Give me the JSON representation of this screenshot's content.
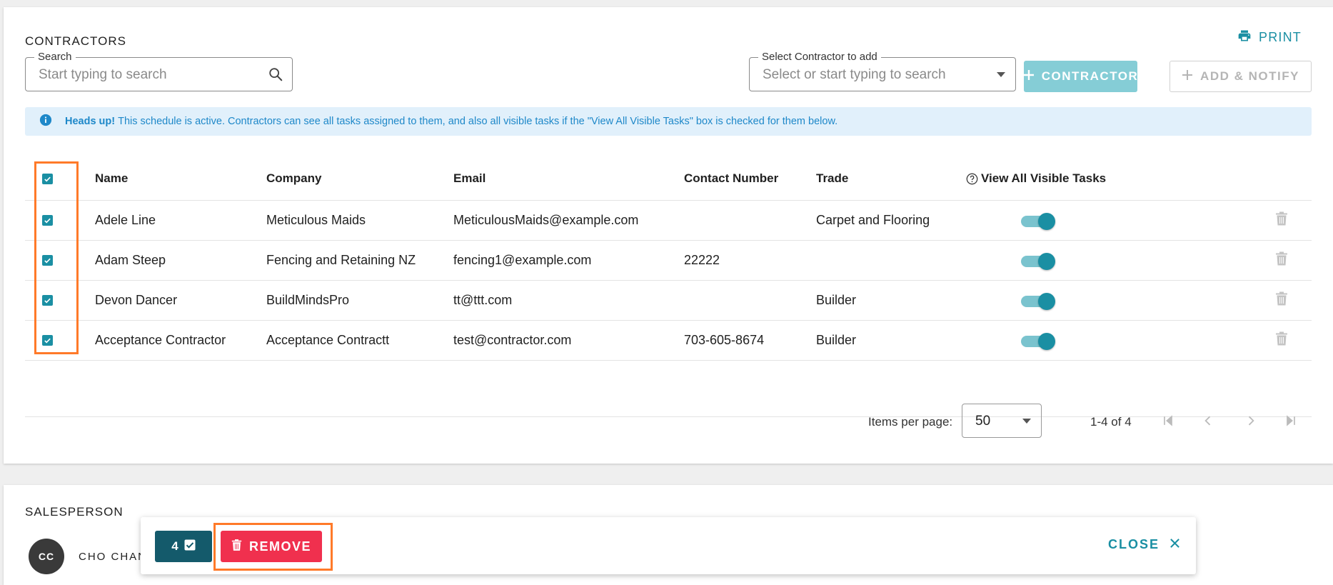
{
  "contractors": {
    "title": "CONTRACTORS",
    "print_label": "PRINT",
    "search": {
      "label": "Search",
      "placeholder": "Start typing to search"
    },
    "select": {
      "label": "Select Contractor to add",
      "placeholder": "Select or start typing to search"
    },
    "add_contractor_label": "CONTRACTOR",
    "add_notify_label": "ADD & NOTIFY",
    "alert": {
      "bold": "Heads up!",
      "text": "This schedule is active. Contractors can see all tasks assigned to them, and also all visible tasks if the \"View All Visible Tasks\" box is checked for them below."
    },
    "table": {
      "headers": {
        "name": "Name",
        "company": "Company",
        "email": "Email",
        "contact": "Contact Number",
        "trade": "Trade",
        "visible": "View All Visible Tasks"
      },
      "rows": [
        {
          "name": "Adele Line",
          "company": "Meticulous Maids",
          "email": "MeticulousMaids@example.com",
          "contact": "",
          "trade": "Carpet and Flooring",
          "visible": true,
          "checked": true
        },
        {
          "name": "Adam Steep",
          "company": "Fencing and Retaining NZ",
          "email": "fencing1@example.com",
          "contact": "22222",
          "trade": "",
          "visible": true,
          "checked": true
        },
        {
          "name": "Devon Dancer",
          "company": "BuildMindsPro",
          "email": "tt@ttt.com",
          "contact": "",
          "trade": "Builder",
          "visible": true,
          "checked": true
        },
        {
          "name": "Acceptance Contractor",
          "company": "Acceptance Contractt",
          "email": "test@contractor.com",
          "contact": "703-605-8674",
          "trade": "Builder",
          "visible": true,
          "checked": true
        }
      ]
    },
    "pagination": {
      "items_per_page_label": "Items per page:",
      "items_per_page": "50",
      "range": "1-4 of 4"
    }
  },
  "salesperson": {
    "title": "SALESPERSON",
    "initials": "CC",
    "name": "CHO CHAN"
  },
  "bulk_bar": {
    "count": "4",
    "remove_label": "REMOVE",
    "close_label": "CLOSE"
  },
  "colors": {
    "accent": "#1a8fa3",
    "danger": "#f0304e",
    "highlight": "#ff7a29",
    "alert_bg": "#e1f0fb"
  }
}
